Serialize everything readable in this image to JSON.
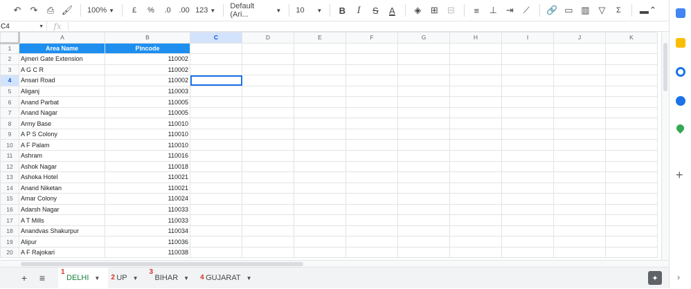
{
  "toolbar": {
    "zoom": "100%",
    "currency": "£",
    "percent": "%",
    "dec_decrease": ".0",
    "dec_increase": ".00",
    "more_formats": "123",
    "font_family": "Default (Ari...",
    "font_size": "10",
    "bold": "B",
    "italic": "I",
    "strike": "S",
    "text_color": "A",
    "sum": "Σ"
  },
  "formula_bar": {
    "cell_ref": "C4",
    "fx": "fx",
    "value": ""
  },
  "columns": [
    "A",
    "B",
    "C",
    "D",
    "E",
    "F",
    "G",
    "H",
    "I",
    "J",
    "K"
  ],
  "active_cell": {
    "row": 4,
    "col": "C"
  },
  "rows": [
    {
      "n": "1",
      "a": "Area Name",
      "b": "Pincode",
      "header": true
    },
    {
      "n": "2",
      "a": "Ajmeri Gate Extension",
      "b": "110002"
    },
    {
      "n": "3",
      "a": "A G C R",
      "b": "110002"
    },
    {
      "n": "4",
      "a": "Ansari Road",
      "b": "110002"
    },
    {
      "n": "5",
      "a": "Aliganj",
      "b": "110003"
    },
    {
      "n": "6",
      "a": "Anand Parbat",
      "b": "110005"
    },
    {
      "n": "7",
      "a": "Anand Nagar",
      "b": "110005"
    },
    {
      "n": "8",
      "a": "Army Base",
      "b": "110010"
    },
    {
      "n": "9",
      "a": "A P S Colony",
      "b": "110010"
    },
    {
      "n": "10",
      "a": "A F Palam",
      "b": "110010"
    },
    {
      "n": "11",
      "a": "Ashram",
      "b": "110016"
    },
    {
      "n": "12",
      "a": "Ashok Nagar",
      "b": "110018"
    },
    {
      "n": "13",
      "a": "Ashoka Hotel",
      "b": "110021"
    },
    {
      "n": "14",
      "a": "Anand Niketan",
      "b": "110021"
    },
    {
      "n": "15",
      "a": "Amar Colony",
      "b": "110024"
    },
    {
      "n": "16",
      "a": "Adarsh Nagar",
      "b": "110033"
    },
    {
      "n": "17",
      "a": "A T Mills",
      "b": "110033"
    },
    {
      "n": "18",
      "a": "Anandvas Shakurpur",
      "b": "110034"
    },
    {
      "n": "19",
      "a": "Alipur",
      "b": "110036"
    },
    {
      "n": "20",
      "a": "A F Rajokari",
      "b": "110038"
    }
  ],
  "sheets": [
    {
      "label": "DELHI",
      "anno": "1",
      "active": true
    },
    {
      "label": "UP",
      "anno": "2",
      "active": false
    },
    {
      "label": "BIHAR",
      "anno": "3",
      "active": false
    },
    {
      "label": "GUJARAT",
      "anno": "4",
      "active": false
    }
  ],
  "colors": {
    "header_fill": "#1e8fef",
    "active_tab_text": "#188038",
    "annotation": "#d93025",
    "selection": "#1a73e8"
  }
}
